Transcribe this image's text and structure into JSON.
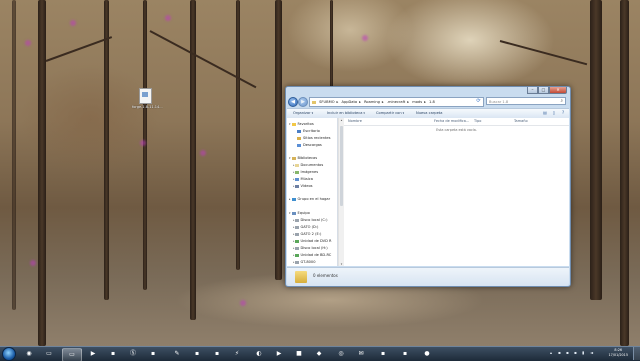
{
  "desktop": {
    "icon_label": "forge-1.8-11.14..."
  },
  "window": {
    "controls": {
      "minimize": "–",
      "maximize": "□",
      "close": "✕"
    },
    "nav": {
      "back": "◀",
      "forward": "▶"
    },
    "address": [
      "SFUBMO",
      "AppData",
      "Roaming",
      ".minecraft",
      "mods",
      "1.8"
    ],
    "address_sep": "▸",
    "search_placeholder": "Buscar 1.8",
    "toolbar": {
      "organize": "Organizar",
      "include_library": "Incluir en biblioteca",
      "share_with": "Compartir con",
      "new_folder": "Nueva carpeta"
    },
    "nav_pane": {
      "favorites": {
        "header": "Favoritos",
        "items": [
          "Escritorio",
          "Sitios recientes",
          "Descargas"
        ]
      },
      "libraries": {
        "header": "Bibliotecas",
        "items": [
          "Documentos",
          "Imágenes",
          "Música",
          "Vídeos"
        ]
      },
      "homegroup": "Grupo en el hogar",
      "computer": {
        "header": "Equipo",
        "items": [
          "Disco local (C:)",
          "GATO (D:)",
          "GATO 2 (E:)",
          "Unidad de DVD R",
          "Disco local (H:)",
          "Unidad de BD-RC",
          "GT-8000"
        ]
      }
    },
    "columns": {
      "name": "Nombre",
      "date": "Fecha de modifica...",
      "type": "Tipo",
      "size": "Tamaño"
    },
    "empty_message": "Esta carpeta está vacía.",
    "status": "0 elementos"
  },
  "taskbar": {
    "clock_time": "8:26",
    "clock_date": "17/01/2015"
  },
  "colors": {
    "window_frame": "#c9dcef",
    "taskbar": "#1d2a38",
    "accent": "#2e68b8"
  }
}
